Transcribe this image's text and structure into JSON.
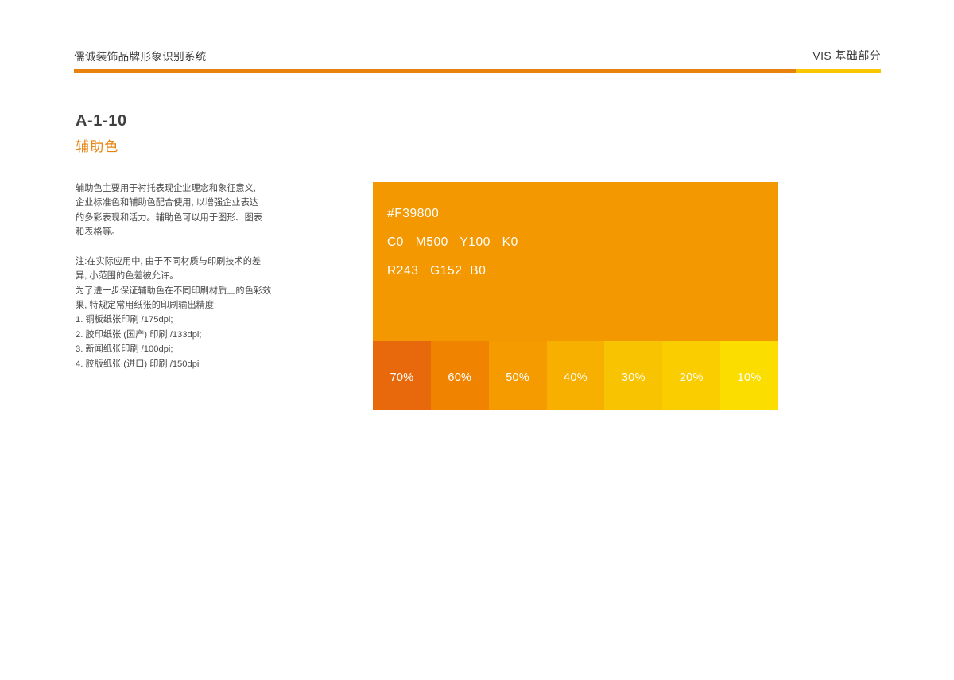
{
  "header": {
    "title_left": "儒诚装饰品牌形象识别系统",
    "title_right": "VIS 基础部分",
    "rule_orange": "#e8820e",
    "rule_yellow": "#f9c700"
  },
  "page": {
    "code": "A-1-10",
    "subtitle": "辅助色",
    "subtitle_color": "#e8820e"
  },
  "intro": {
    "line1": "辅助色主要用于衬托表现企业理念和象征意义,",
    "line2": "企业标准色和辅助色配合使用, 以增强企业表达",
    "line3": "的多彩表现和活力。辅助色可以用于图形、图表",
    "line4": "和表格等。"
  },
  "note": {
    "line1": "注:在实际应用中, 由于不同材质与印刷技术的差",
    "line2": "异, 小范围的色差被允许。",
    "line3": "为了进一步保证辅助色在不同印刷材质上的色彩效",
    "line4": "果, 特规定常用纸张的印刷输出精度:"
  },
  "specs": {
    "items": [
      "1. 铜板纸张印刷 /175dpi;",
      "2. 胶印纸张 (国产) 印刷 /133dpi;",
      "3. 新闻纸张印刷 /100dpi;",
      "4. 胶版纸张 (进口) 印刷 /150dpi"
    ]
  },
  "color_panel": {
    "main_color": "#f39800",
    "hex_line": "#F39800",
    "cmyk_line": "C0   M500   Y100   K0",
    "rgb_line": "R243   G152  B0",
    "tints": [
      {
        "label": "70%",
        "color": "#e8690b"
      },
      {
        "label": "60%",
        "color": "#f08300"
      },
      {
        "label": "50%",
        "color": "#f59b00"
      },
      {
        "label": "40%",
        "color": "#f7af00"
      },
      {
        "label": "30%",
        "color": "#f8c300"
      },
      {
        "label": "20%",
        "color": "#facd00"
      },
      {
        "label": "10%",
        "color": "#fcdd00"
      }
    ]
  }
}
